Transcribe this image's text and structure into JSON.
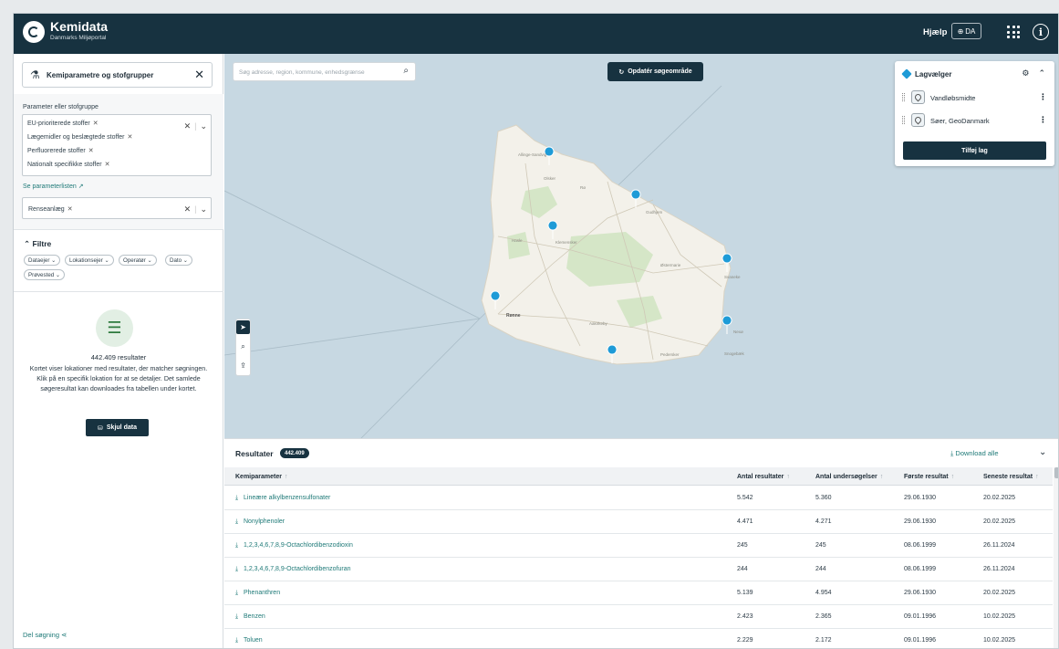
{
  "header": {
    "app_name": "Kemidata",
    "app_subtitle": "Danmarks Miljøportal",
    "help_label": "Hjælp",
    "language_label": "DA"
  },
  "sidebar": {
    "panel_title": "Kemiparametre og stofgrupper",
    "param_label": "Parameter eller stofgruppe",
    "selected_params": [
      "EU-prioriterede stoffer",
      "Lægemidler og beslægtede stoffer",
      "Perfluorerede stoffer",
      "Nationalt specifikke stoffer"
    ],
    "param_list_link": "Se parameterlisten",
    "location_type_value": "Renseanlæg",
    "filters_title": "Filtre",
    "filter_pills": [
      "Dataejer",
      "Lokationsejer",
      "Operatør",
      "Dato",
      "Prøvested"
    ],
    "result_count_text": "442.409 resultater",
    "result_description": "Kortet viser lokationer med resultater, der matcher søgningen. Klik på en specifik lokation for at se detaljer. Det samlede søgeresultat kan downloades fra tabellen under kortet.",
    "hide_data_label": "Skjul data",
    "share_label": "Del søgning"
  },
  "map": {
    "search_placeholder": "Søg adresse, region, kommune, enhedsgrænse",
    "update_button_label": "Opdatér søgeområde",
    "town_labels": [
      "Rønne",
      "Allinge-Sandvig",
      "Gudhjem",
      "Svaneke",
      "Nexø",
      "Aakirkeby",
      "Østermarie",
      "Klemensker",
      "Hasle",
      "Pedersker",
      "Olsker",
      "Rø",
      "Snogebæk"
    ],
    "tools": [
      "cursor-icon",
      "zoom-icon",
      "upload-icon"
    ]
  },
  "layers": {
    "title": "Lagvælger",
    "items": [
      "Vandløbsmidte",
      "Søer, GeoDanmark"
    ],
    "add_label": "Tilføj lag"
  },
  "results": {
    "title": "Resultater",
    "count_badge": "442.409",
    "download_all_label": "Download alle",
    "columns": [
      "Kemiparameter",
      "Antal resultater",
      "Antal undersøgelser",
      "Første resultat",
      "Seneste resultat"
    ],
    "rows": [
      [
        "Lineære alkylbenzensulfonater",
        "5.542",
        "5.360",
        "29.06.1930",
        "20.02.2025"
      ],
      [
        "Nonylphenoler",
        "4.471",
        "4.271",
        "29.06.1930",
        "20.02.2025"
      ],
      [
        "1,2,3,4,6,7,8,9-Octachlordibenzodioxin",
        "245",
        "245",
        "08.06.1999",
        "26.11.2024"
      ],
      [
        "1,2,3,4,6,7,8,9-Octachlordibenzofuran",
        "244",
        "244",
        "08.06.1999",
        "26.11.2024"
      ],
      [
        "Phenanthren",
        "5.139",
        "4.954",
        "29.06.1930",
        "20.02.2025"
      ],
      [
        "Benzen",
        "2.423",
        "2.365",
        "09.01.1996",
        "10.02.2025"
      ],
      [
        "Toluen",
        "2.229",
        "2.172",
        "09.01.1996",
        "10.02.2025"
      ]
    ]
  },
  "colors": {
    "header_bg": "#173240",
    "accent_teal": "#1f7a78",
    "map_sea": "#c7d8e2",
    "marker_blue": "#1e9bd7"
  }
}
